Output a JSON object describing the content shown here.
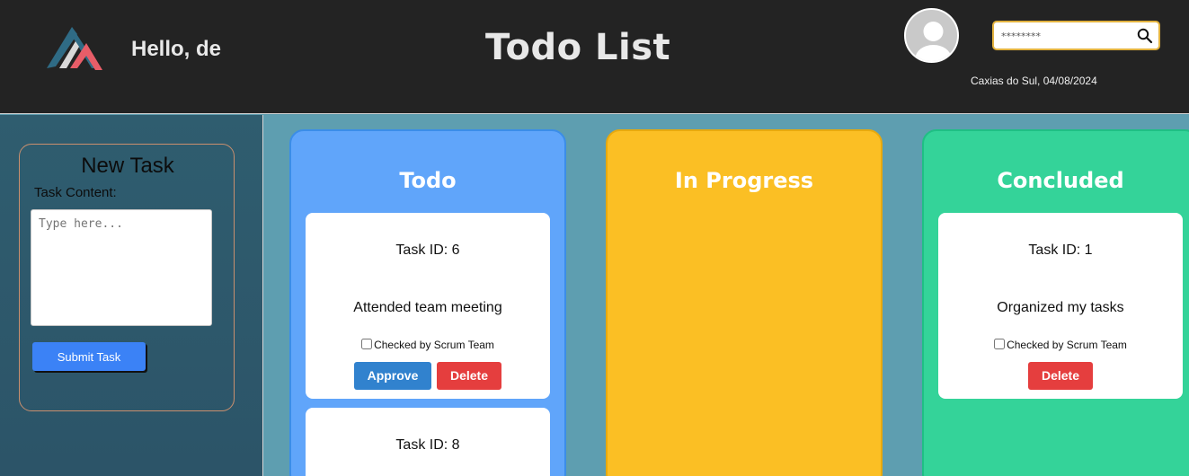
{
  "header": {
    "greeting": "Hello, de",
    "title": "Todo List",
    "search_placeholder": "********",
    "location_date": "Caxias do Sul, 04/08/2024"
  },
  "sidebar": {
    "new_task_title": "New Task",
    "content_label": "Task Content:",
    "textarea_placeholder": "Type here...",
    "submit_label": "Submit Task"
  },
  "columns": {
    "todo": {
      "title": "Todo",
      "cards": [
        {
          "id_label": "Task ID: 6",
          "content": "Attended team meeting",
          "check_label": "Checked by Scrum Team",
          "approve_label": "Approve",
          "delete_label": "Delete"
        },
        {
          "id_label": "Task ID: 8"
        }
      ]
    },
    "progress": {
      "title": "In Progress"
    },
    "done": {
      "title": "Concluded",
      "cards": [
        {
          "id_label": "Task ID: 1",
          "content": "Organized my tasks",
          "check_label": "Checked by Scrum Team",
          "delete_label": "Delete"
        }
      ]
    }
  },
  "colors": {
    "todo": "#60a5fa",
    "progress": "#fbbf24",
    "done": "#34d399",
    "approve": "#3182ce",
    "delete": "#e53e3e"
  },
  "icons": [
    "logo-icon",
    "avatar-icon",
    "search-icon"
  ]
}
